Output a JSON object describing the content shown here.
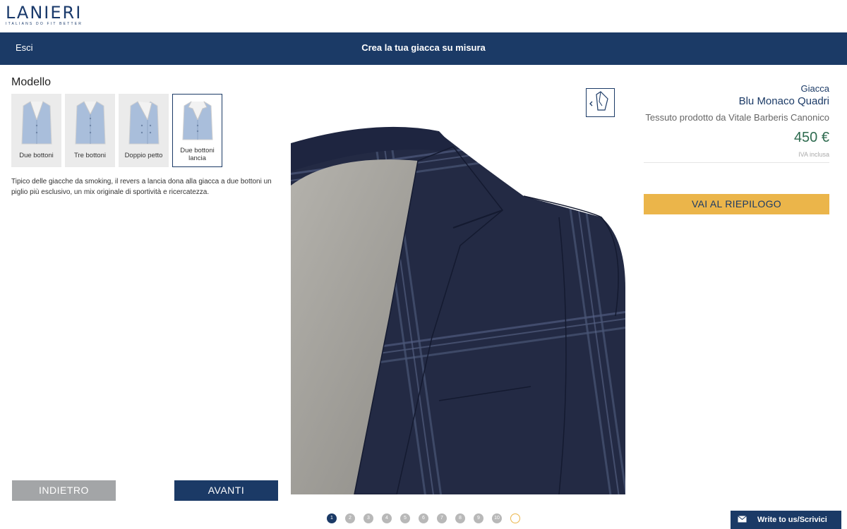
{
  "brand": {
    "name": "LANIERI",
    "tagline": "ITALIANS DO FIT BETTER"
  },
  "nav": {
    "exit": "Esci",
    "title": "Crea la tua giacca su misura"
  },
  "model_section": {
    "title": "Modello",
    "options": [
      {
        "label": "Due bottoni",
        "selected": false
      },
      {
        "label": "Tre bottoni",
        "selected": false
      },
      {
        "label": "Doppio petto",
        "selected": false
      },
      {
        "label": "Due bottoni lancia",
        "selected": true
      }
    ],
    "description": "Tipico delle giacche da smoking, il revers a lancia dona alla giacca a due bottoni un piglio più esclusivo, un mix originale di sportività e ricercatezza."
  },
  "buttons": {
    "back": "INDIETRO",
    "next": "AVANTI",
    "summary": "VAI AL RIEPILOGO"
  },
  "product": {
    "category": "Giacca",
    "name": "Blu Monaco Quadri",
    "fabric": "Tessuto prodotto da Vitale Barberis Canonico",
    "price": "450 €",
    "vat": "IVA inclusa"
  },
  "pager": {
    "steps": [
      "1",
      "2",
      "3",
      "4",
      "5",
      "6",
      "7",
      "8",
      "9",
      "10",
      ""
    ],
    "active_index": 0
  },
  "contact": {
    "label": "Write to us/Scrivici"
  },
  "colors": {
    "navy": "#1b3a66",
    "gold": "#ebb54a",
    "price_green": "#2e6b4f",
    "grey_button": "#a3a5a7"
  },
  "icons": {
    "view_toggle": "rotate-view-icon",
    "contact": "envelope-icon"
  }
}
